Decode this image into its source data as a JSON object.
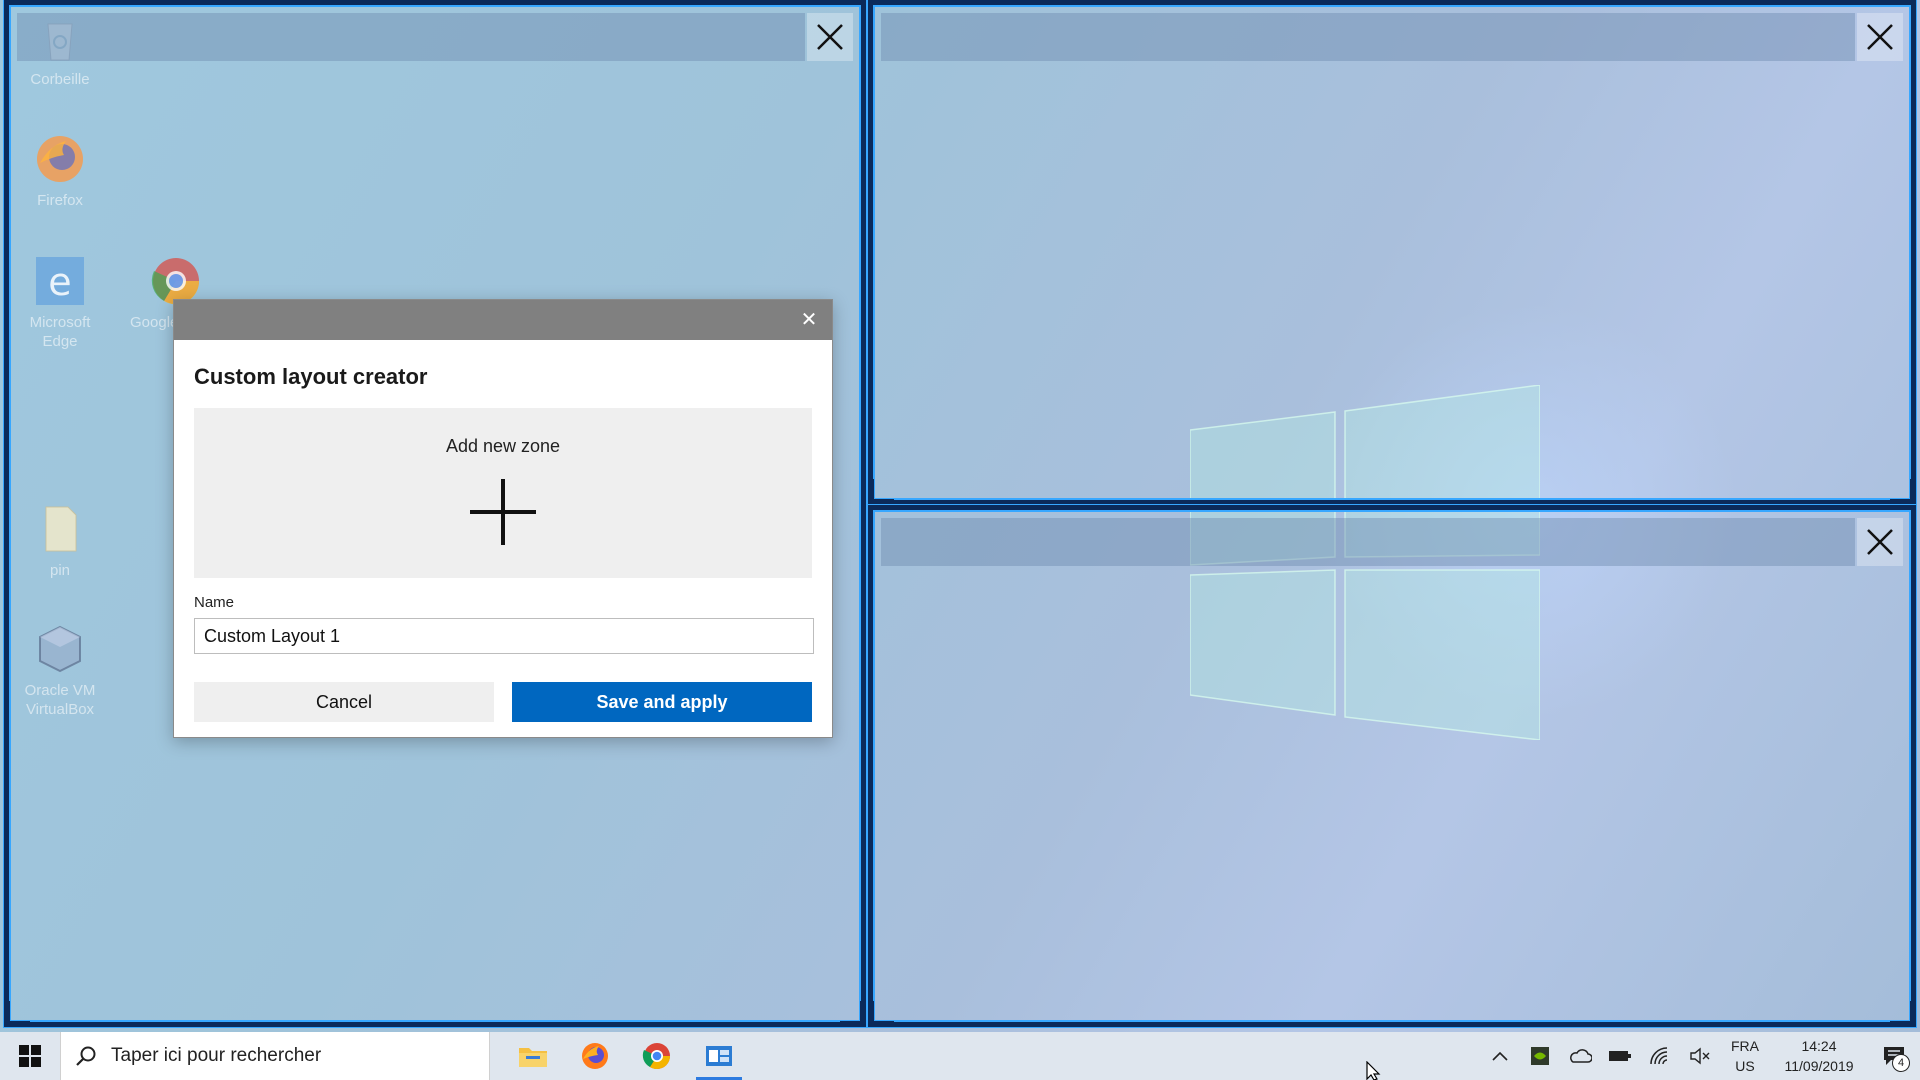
{
  "desktop": {
    "icons": [
      {
        "label": "Corbeille",
        "icon": "recycle-bin-icon"
      },
      {
        "label": "Firefox",
        "icon": "firefox-icon"
      },
      {
        "label": "Microsoft Edge",
        "icon": "edge-icon"
      },
      {
        "label": "Google",
        "icon": "chrome-icon"
      },
      {
        "label": "pin",
        "icon": "folder-icon"
      },
      {
        "label": "Oracle VM VirtualBox",
        "icon": "virtualbox-icon"
      }
    ]
  },
  "zones": {
    "close_glyph": "close-icon",
    "accent": "#37a7ff",
    "border": "#0b2a5a"
  },
  "dialog": {
    "close_glyph": "✕",
    "title": "Custom layout creator",
    "add_zone_label": "Add new zone",
    "name_label": "Name",
    "name_value": "Custom Layout 1",
    "cancel_label": "Cancel",
    "save_label": "Save and apply",
    "accent": "#0067c0"
  },
  "taskbar": {
    "search_placeholder": "Taper ici pour rechercher",
    "apps": [
      "file-explorer-icon",
      "firefox-icon",
      "chrome-icon",
      "fancyzones-editor-icon"
    ],
    "lang_top": "FRA",
    "lang_bottom": "US",
    "time": "14:24",
    "date": "11/09/2019",
    "notification_count": "4"
  }
}
